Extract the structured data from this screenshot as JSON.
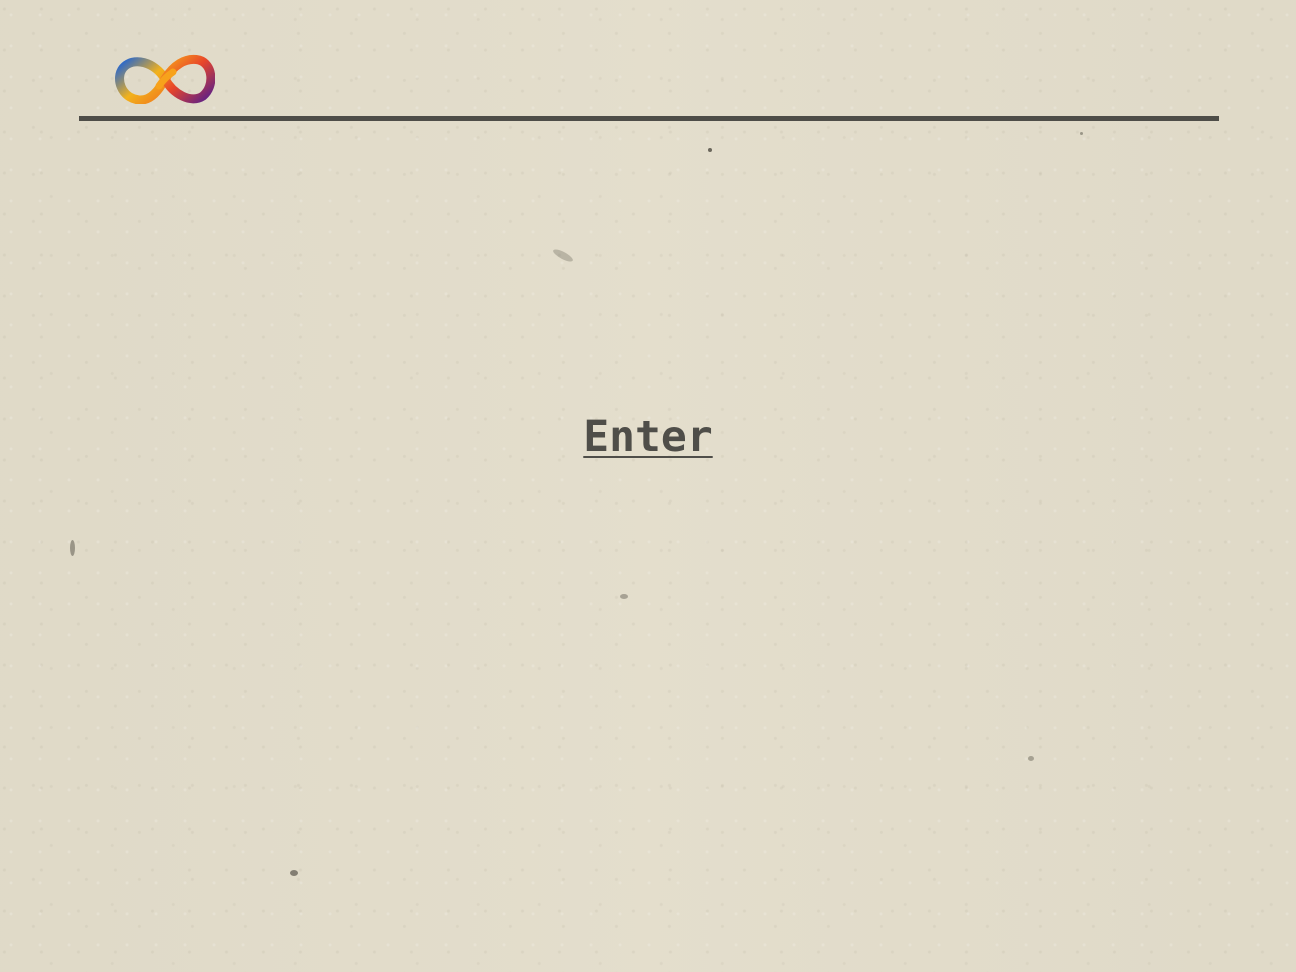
{
  "logo": {
    "icon": "infinity-logo-icon",
    "colors": [
      "#1e63d6",
      "#f7a21b",
      "#e8462a",
      "#8a2c9a",
      "#5a1f8a"
    ]
  },
  "main": {
    "enter_label": "Enter"
  },
  "colors": {
    "background": "#e3ddcb",
    "rule": "#4e4d48",
    "link": "#4f4e49"
  }
}
